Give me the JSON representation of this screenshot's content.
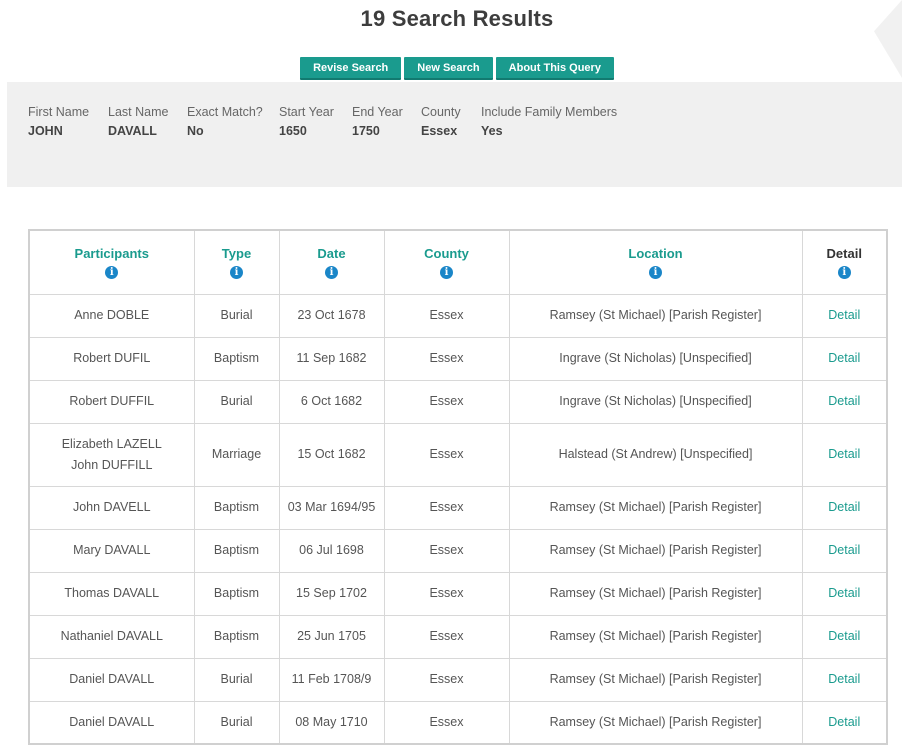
{
  "page": {
    "title": "19 Search Results"
  },
  "buttons": {
    "revise": "Revise Search",
    "new": "New Search",
    "about": "About This Query"
  },
  "query": [
    {
      "label": "First Name",
      "value": "JOHN"
    },
    {
      "label": "Last Name",
      "value": "DAVALL"
    },
    {
      "label": "Exact Match?",
      "value": "No"
    },
    {
      "label": "Start Year",
      "value": "1650"
    },
    {
      "label": "End Year",
      "value": "1750"
    },
    {
      "label": "County",
      "value": "Essex"
    },
    {
      "label": "Include Family Members",
      "value": "Yes"
    }
  ],
  "table": {
    "headers": [
      "Participants",
      "Type",
      "Date",
      "County",
      "Location",
      "Detail"
    ],
    "info_glyph": "i",
    "rows": [
      {
        "participants": [
          "Anne DOBLE"
        ],
        "type": "Burial",
        "date": "23 Oct 1678",
        "county": "Essex",
        "location": "Ramsey (St Michael) [Parish Register]",
        "detail": "Detail"
      },
      {
        "participants": [
          "Robert DUFIL"
        ],
        "type": "Baptism",
        "date": "11 Sep 1682",
        "county": "Essex",
        "location": "Ingrave (St Nicholas) [Unspecified]",
        "detail": "Detail"
      },
      {
        "participants": [
          "Robert DUFFIL"
        ],
        "type": "Burial",
        "date": "6 Oct 1682",
        "county": "Essex",
        "location": "Ingrave (St Nicholas) [Unspecified]",
        "detail": "Detail"
      },
      {
        "participants": [
          "Elizabeth LAZELL",
          "John DUFFILL"
        ],
        "type": "Marriage",
        "date": "15 Oct 1682",
        "county": "Essex",
        "location": "Halstead (St Andrew) [Unspecified]",
        "detail": "Detail"
      },
      {
        "participants": [
          "John DAVELL"
        ],
        "type": "Baptism",
        "date": "03 Mar 1694/95",
        "county": "Essex",
        "location": "Ramsey (St Michael) [Parish Register]",
        "detail": "Detail"
      },
      {
        "participants": [
          "Mary DAVALL"
        ],
        "type": "Baptism",
        "date": "06 Jul 1698",
        "county": "Essex",
        "location": "Ramsey (St Michael) [Parish Register]",
        "detail": "Detail"
      },
      {
        "participants": [
          "Thomas DAVALL"
        ],
        "type": "Baptism",
        "date": "15 Sep 1702",
        "county": "Essex",
        "location": "Ramsey (St Michael) [Parish Register]",
        "detail": "Detail"
      },
      {
        "participants": [
          "Nathaniel DAVALL"
        ],
        "type": "Baptism",
        "date": "25 Jun 1705",
        "county": "Essex",
        "location": "Ramsey (St Michael) [Parish Register]",
        "detail": "Detail"
      },
      {
        "participants": [
          "Daniel DAVALL"
        ],
        "type": "Burial",
        "date": "11 Feb 1708/9",
        "county": "Essex",
        "location": "Ramsey (St Michael) [Parish Register]",
        "detail": "Detail"
      },
      {
        "participants": [
          "Daniel DAVALL"
        ],
        "type": "Burial",
        "date": "08 May 1710",
        "county": "Essex",
        "location": "Ramsey (St Michael) [Parish Register]",
        "detail": "Detail"
      }
    ]
  }
}
